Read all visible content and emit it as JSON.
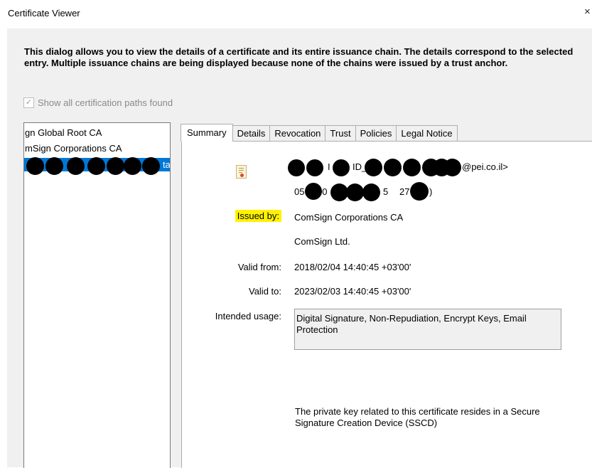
{
  "window": {
    "title": "Certificate Viewer",
    "close_icon": "×"
  },
  "intro": "This dialog allows you to view the details of a certificate and its entire issuance chain. The details correspond to the selected entry. Multiple issuance chains are being displayed because none of the chains were issued by a trust anchor.",
  "show_paths": {
    "label": "Show all certification paths found",
    "checked": true,
    "enabled": false
  },
  "tree": {
    "items": [
      {
        "label": "gn Global Root CA"
      },
      {
        "label": "mSign Corporations CA"
      },
      {
        "label": "ta",
        "selected": true
      }
    ]
  },
  "tabs": [
    "Summary",
    "Details",
    "Revocation",
    "Trust",
    "Policies",
    "Legal Notice"
  ],
  "summary": {
    "subject_fragments": {
      "f1": "I",
      "f2": "ID_",
      "f3": "@pei.co.il>"
    },
    "serial_fragments": {
      "f1": "05",
      "f2": "00",
      "f3": "5",
      "f4": "27",
      "f5": ")"
    },
    "issued_by_label": "Issued by:",
    "issuer_cn": "ComSign Corporations CA",
    "issuer_org": "ComSign Ltd.",
    "valid_from_label": "Valid from:",
    "valid_from": "2018/02/04 14:40:45 +03'00'",
    "valid_to_label": "Valid to:",
    "valid_to": "2023/02/03 14:40:45 +03'00'",
    "usage_label": "Intended usage:",
    "usage_value": "Digital Signature, Non-Repudiation, Encrypt Keys, Email Protection",
    "sscd_note": "The private key related to this certificate resides in a Secure Signature Creation Device (SSCD)"
  },
  "colors": {
    "selection": "#0078d7",
    "highlight": "#fff200",
    "redaction": "#000000"
  }
}
